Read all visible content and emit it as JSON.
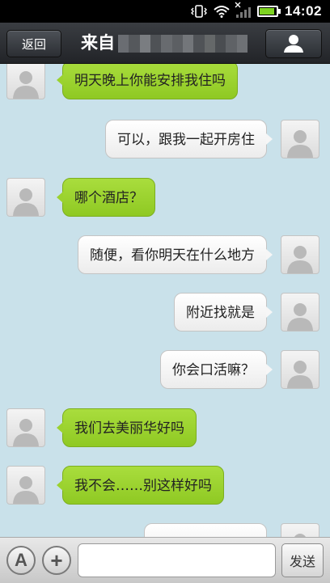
{
  "status_bar": {
    "time": "14:02",
    "icons": [
      "vibrate-icon",
      "wifi-icon",
      "no-signal-icon",
      "battery-icon"
    ]
  },
  "header": {
    "back_label": "返回",
    "title_prefix": "来自",
    "profile_icon": "person-icon"
  },
  "messages": [
    {
      "side": "left",
      "text": "明天晚上你能安排我住吗"
    },
    {
      "side": "right",
      "text": "可以，跟我一起开房住"
    },
    {
      "side": "left",
      "text": "哪个酒店？"
    },
    {
      "side": "right",
      "text": "随便，看你明天在什么地方"
    },
    {
      "side": "right",
      "text": "附近找就是"
    },
    {
      "side": "right",
      "text": "你会口活嘛？"
    },
    {
      "side": "left",
      "text": "我们去美丽华好吗"
    },
    {
      "side": "left",
      "text": "我不会……别这样好吗"
    },
    {
      "side": "right",
      "text": ""
    }
  ],
  "input_bar": {
    "font_button": "A",
    "add_button": "+",
    "input_value": "",
    "send_label": "发送"
  },
  "colors": {
    "chat_background": "#c9e1ea",
    "incoming_bubble": "#9bd22f",
    "outgoing_bubble": "#f6f6f6",
    "header_bar": "#2c2f33"
  }
}
